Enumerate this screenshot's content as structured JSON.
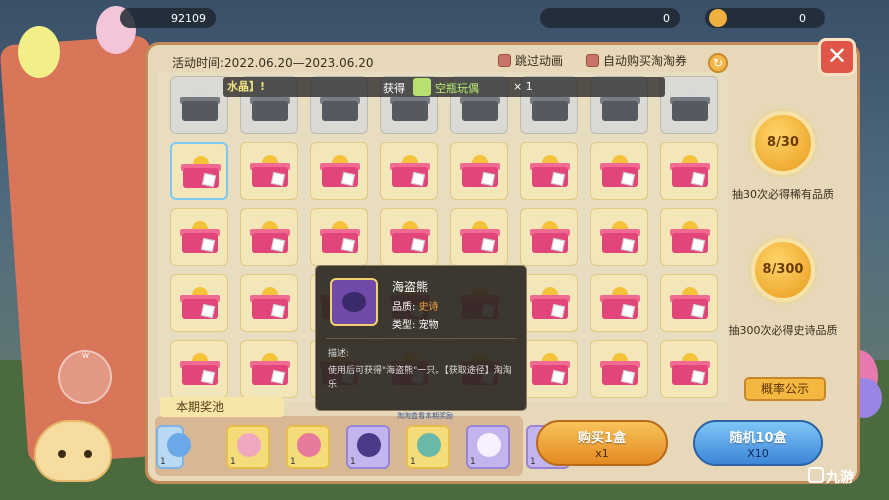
{
  "hud": {
    "gold": "92109",
    "coins": "0",
    "tickets": "0"
  },
  "header": {
    "activity_time": "活动时间:2022.06.20—2023.06.20",
    "skip_animation": "跳过动画",
    "auto_buy": "自动购买淘淘券",
    "close": "✕",
    "refresh": "↻"
  },
  "notice": {
    "tag": "水晶】!",
    "got": "获得",
    "item": "空瓶玩偶",
    "count": "× 1"
  },
  "grid": {
    "opened_count": 8,
    "selected": 0
  },
  "tooltip": {
    "name": "海盗熊",
    "quality_label": "品质:",
    "quality_value": "史诗",
    "type_label": "类型:",
    "type_value": "宠物",
    "desc_header": "描述:",
    "desc": "使用后可获得\"海盗熊\"一只。【获取途径】淘淘乐"
  },
  "right_panel": {
    "medal_a": "8/30",
    "medal_a_text": "抽30次必得稀有品质",
    "medal_b": "8/300",
    "medal_b_text": "抽300次必得史诗品质",
    "prob_button": "概率公示"
  },
  "pool": {
    "title": "本期奖池",
    "hint": "淘淘盒看本期奖励",
    "item_qty": "1"
  },
  "buy": {
    "one_label": "购买1盒",
    "one_count": "x1",
    "ten_label": "随机10盒",
    "ten_count": "X10"
  },
  "joystick": {
    "label": "W"
  },
  "watermark": "九游",
  "colors": {
    "accent": "#f4b840",
    "epic": "#f0a03a",
    "panel": "#e6d8b8",
    "gift": "#e2457a"
  }
}
